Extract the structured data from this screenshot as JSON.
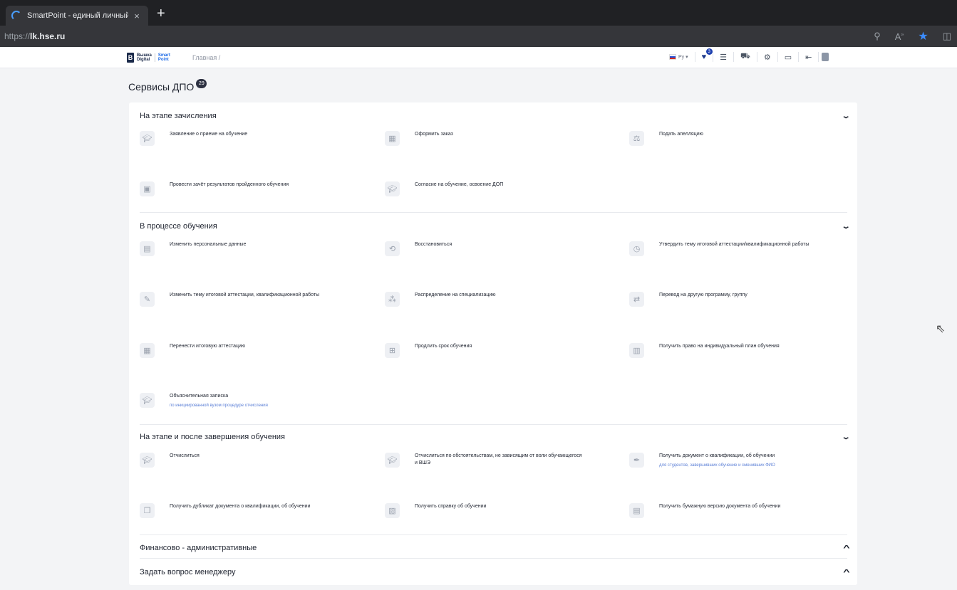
{
  "browser": {
    "tab_title": "SmartPoint - единый личный ка",
    "tab_close": "×",
    "new_tab": "+",
    "url_scheme": "https://",
    "url_host": "lk.hse.ru",
    "icons": [
      "zoom-icon",
      "read-aloud-icon",
      "favorite-star-icon",
      "split-screen-icon"
    ]
  },
  "header": {
    "logo_line1": "Вышка",
    "logo_line2": "Digital",
    "logo_smart": "Smart",
    "logo_point": "Point",
    "breadcrumb": "Главная  /",
    "lang": "Ру ▾",
    "favorites_count": "3"
  },
  "page": {
    "title": "Сервисы ДПО",
    "count": "29"
  },
  "sections": [
    {
      "title": "На этапе зачисления",
      "chevron": "⌄",
      "items": [
        {
          "label": "Заявление о приеме на обучение"
        },
        {
          "label": "Оформить заказ"
        },
        {
          "label": "Подать апелляцию"
        },
        {
          "label": "Провести зачёт результатов пройденного обучения"
        },
        {
          "label": "Согласие на обучение, освоение ДОП"
        }
      ]
    },
    {
      "title": "В процессе обучения",
      "chevron": "⌄",
      "items": [
        {
          "label": "Изменить персональные данные"
        },
        {
          "label": "Восстановиться"
        },
        {
          "label": "Утвердить тему итоговой аттестации/квалификационной работы"
        },
        {
          "label": "Изменить тему итоговой аттестации, квалификационной работы"
        },
        {
          "label": "Распределение на специализацию"
        },
        {
          "label": "Перевод на другую программу, группу"
        },
        {
          "label": "Перенести итоговую аттестацию"
        },
        {
          "label": "Продлить срок обучения"
        },
        {
          "label": "Получить право на индивидуальный план обучения"
        },
        {
          "label": "Объяснительная записка",
          "sub": "по инициированной вузом процедуре отчисления"
        }
      ]
    },
    {
      "title": "На этапе и после завершения обучения",
      "chevron": "⌄",
      "items": [
        {
          "label": "Отчислиться"
        },
        {
          "label": "Отчислиться по обстоятельствам, не зависящим от воли обучающегося и ВШЭ"
        },
        {
          "label": "Получить документ о квалификации, об обучении",
          "sub": "для студентов, завершивших обучение и сменивших ФИО"
        },
        {
          "label": "Получить дубликат документа о квалификации, об обучении"
        },
        {
          "label": "Получить справку об обучении"
        },
        {
          "label": "Получить бумажную версию документа об обучении"
        }
      ]
    },
    {
      "title": "Финансово - административные",
      "chevron": "^"
    },
    {
      "title": "Задать вопрос менеджеру",
      "chevron": "^"
    }
  ]
}
